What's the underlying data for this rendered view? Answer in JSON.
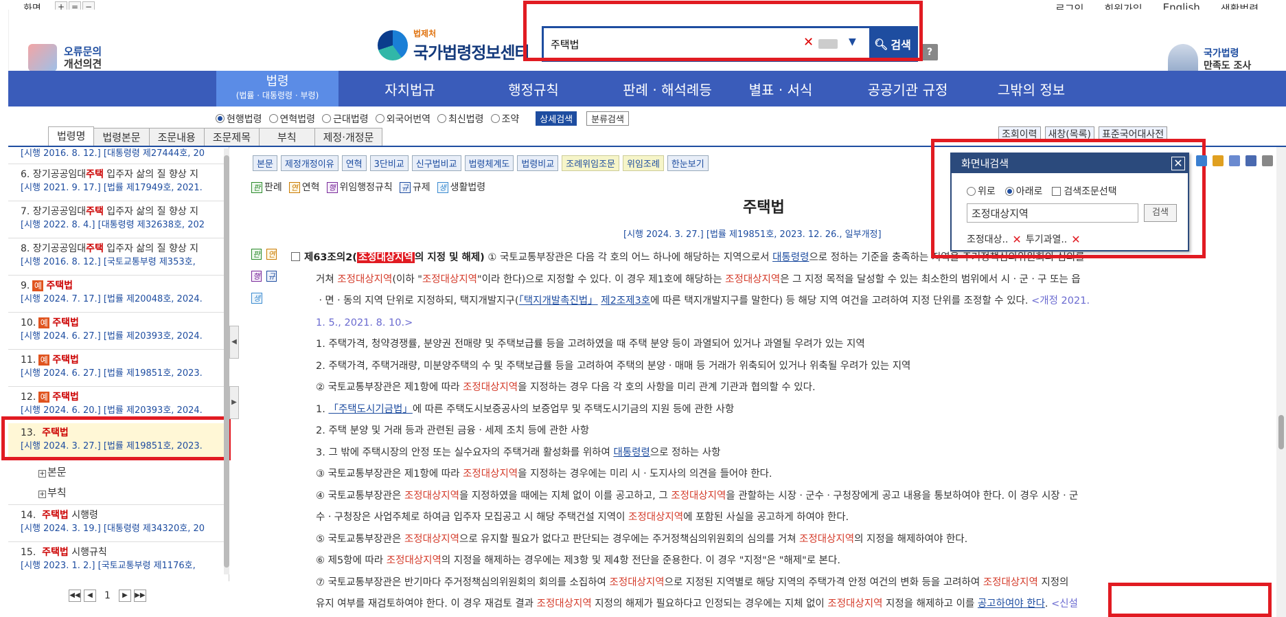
{
  "top": {
    "zoom_label": "화면",
    "zoom_plus": "+",
    "zoom_reset": "=",
    "zoom_minus": "−",
    "links": [
      "로그인",
      "회원가입",
      "English",
      "생활법령"
    ]
  },
  "header": {
    "feedback_line1": "오류문의",
    "feedback_line2": "개선의견",
    "logo_small": "법제처",
    "logo_name": "국가법령정보센터",
    "search_value": "주택법",
    "search_button": "검색",
    "help": "?",
    "survey_line1": "국가법령",
    "survey_line2": "만족도 조사"
  },
  "nav": {
    "active_main": "법령",
    "active_sub": "(법률 · 대통령령 · 부령)",
    "items": [
      "자치법규",
      "행정규칙",
      "판례 · 해석례등",
      "별표 · 서식",
      "공공기관 규정",
      "그밖의 정보"
    ]
  },
  "options": {
    "radios": [
      "현행법령",
      "연혁법령",
      "근대법령",
      "외국어번역",
      "최신법령",
      "조약"
    ],
    "selected": "현행법령",
    "detail_search": "상세검색",
    "class_search": "분류검색"
  },
  "left_tabs": [
    "법령명",
    "법령본문",
    "조문내용",
    "조문제목",
    "부칙",
    "제정·개정문"
  ],
  "right_tools": [
    "조회이력",
    "새창(목록)",
    "표준국어대사전"
  ],
  "left_list": [
    {
      "title_pre": "",
      "title_kw": "",
      "title_post": "",
      "sub": "[시행 2016. 8. 12.] [대통령령 제27444호, 20"
    },
    {
      "title_pre": "6.  장기공공임대",
      "title_kw": "주택",
      "title_post": " 입주자 삶의 질 향상 지",
      "sub": "[시행 2021. 9. 17.] [법률 제17949호, 2021."
    },
    {
      "title_pre": "7.  장기공공임대",
      "title_kw": "주택",
      "title_post": " 입주자 삶의 질 향상 지",
      "sub": "[시행 2022. 8. 4.] [대통령령 제32638호, 202"
    },
    {
      "title_pre": "8.  장기공공임대",
      "title_kw": "주택",
      "title_post": " 입주자 삶의 질 향상 지",
      "sub": "[시행 2016. 8. 12.] [국토교통부령 제353호,"
    },
    {
      "num": "9.",
      "badge": "예",
      "title_kw": "주택법",
      "sub": "[시행 2024. 7. 17.] [법률 제20048호, 2024."
    },
    {
      "num": "10.",
      "badge": "예",
      "title_kw": "주택법",
      "sub": "[시행 2024. 6. 27.] [법률 제20393호, 2024."
    },
    {
      "num": "11.",
      "badge": "예",
      "title_kw": "주택법",
      "sub": "[시행 2024. 6. 27.] [법률 제19851호, 2023."
    },
    {
      "num": "12.",
      "badge": "예",
      "title_kw": "주택법",
      "sub": "[시행 2024. 6. 20.] [법률 제20393호, 2024."
    },
    {
      "num": "13.",
      "title_kw": "주택법",
      "sub": "[시행 2024. 3. 27.] [법률 제19851호, 2023."
    },
    {
      "num": "14.",
      "title_kw": "주택법",
      "title_post": " 시행령",
      "sub": "[시행 2024. 3. 19.] [대통령령 제34320호, 20"
    },
    {
      "num": "15.",
      "title_kw": "주택법",
      "title_post": " 시행규칙",
      "sub": "[시행 2023. 1. 2.] [국토교통부령 제1176호,"
    }
  ],
  "tree": [
    "본문",
    "부칙"
  ],
  "pager": {
    "current": "1"
  },
  "content": {
    "buttons": [
      "본문",
      "제정개정이유",
      "연혁",
      "3단비교",
      "신구법비교",
      "법령체계도",
      "법령비교",
      "조례위임조문",
      "위임조례",
      "한눈보기"
    ],
    "legend": [
      {
        "tag": "판",
        "label": "판례"
      },
      {
        "tag": "연",
        "label": "연혁"
      },
      {
        "tag": "행",
        "label": "위임행정규칙"
      },
      {
        "tag": "규",
        "label": "규제"
      },
      {
        "tag": "생",
        "label": "생활법령"
      }
    ],
    "law_title": "주택법",
    "law_sub": "[시행 2024. 3. 27.] [법률 제19851호, 2023. 12. 26., 일부개정]",
    "article_no": "제63조의2(",
    "article_kw": "조정대상지역",
    "article_head_rest": "의 지정 및 해제)",
    "kw": "조정대상지역"
  },
  "find": {
    "title": "화면내검색",
    "opt_up": "위로",
    "opt_down": "아래로",
    "opt_select": "검색조문선택",
    "value": "조정대상지역",
    "button": "검색",
    "hist1": "조정대상..",
    "hist2": "투기과열.."
  }
}
